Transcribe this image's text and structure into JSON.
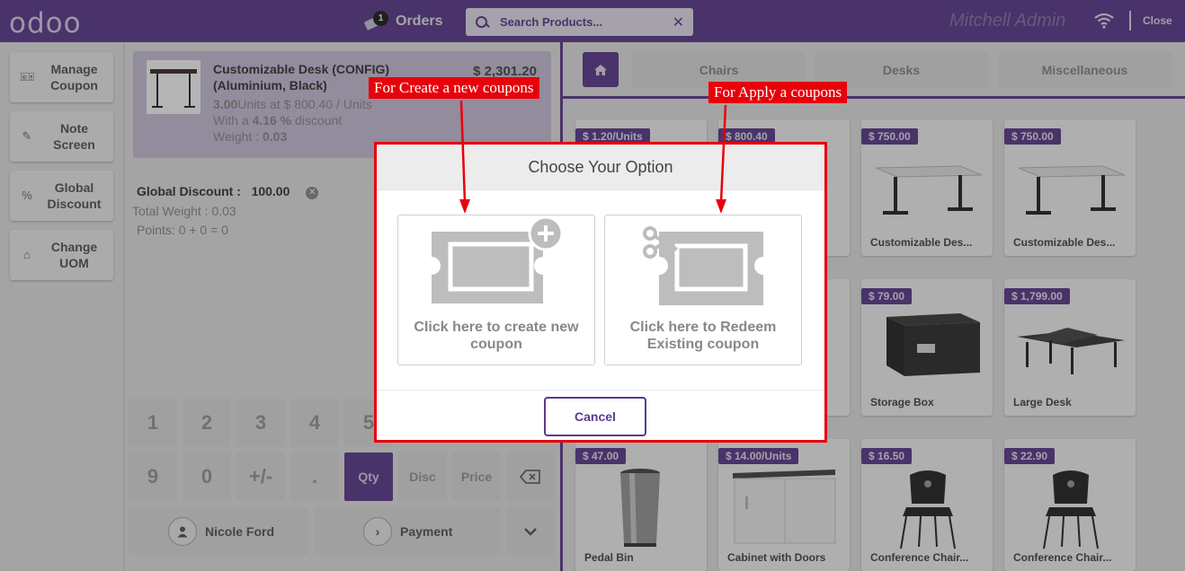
{
  "header": {
    "logo": "odoo",
    "orders_label": "Orders",
    "orders_count": "1",
    "search_placeholder": "Search Products...",
    "user": "Mitchell Admin",
    "close_label": "Close"
  },
  "controls": [
    {
      "label": "Manage Coupon",
      "icon": "ticket-icon"
    },
    {
      "label": "Note Screen",
      "icon": "note-icon"
    },
    {
      "label": "Global Discount",
      "icon": "percent-icon"
    },
    {
      "label": "Change UOM",
      "icon": "tag-icon"
    }
  ],
  "order": {
    "line": {
      "name": "Customizable Desk (CONFIG) (Aluminium, Black)",
      "price": "$ 2,301.20",
      "qty": "3.00",
      "unit_text": "Units at $ 800.40 / Units",
      "discount_prefix": "With a ",
      "discount": "4.16 %",
      "discount_suffix": " discount",
      "weight_label": "Weight : ",
      "weight": "0.03"
    },
    "global_discount_label": "Global Discount :",
    "global_discount_value": "100.00",
    "total_weight": "Total Weight : 0.03",
    "points": "Points: 0 + 0 = 0"
  },
  "numpad": {
    "row1": [
      "1",
      "2",
      "3",
      "4",
      "5"
    ],
    "row2": [
      "9",
      "0",
      "+/-",
      ".",
      "Qty",
      "Disc",
      "Price"
    ],
    "customer": "Nicole Ford",
    "payment": "Payment"
  },
  "categories": {
    "home_icon": "home-icon",
    "items": [
      "Chairs",
      "Desks",
      "Miscellaneous"
    ]
  },
  "products": [
    {
      "price": "$ 1.20/Units",
      "name": ""
    },
    {
      "price": "$ 800.40",
      "name": ""
    },
    {
      "price": "$ 750.00",
      "name": "Customizable Des..."
    },
    {
      "price": "$ 750.00",
      "name": "Customizable Des..."
    },
    {
      "price": "$ 79.00",
      "name": "Storage Box"
    },
    {
      "price": "$ 1,799.00",
      "name": "Large Desk"
    },
    {
      "price": "$ 47.00",
      "name": "Pedal Bin"
    },
    {
      "price": "$ 14.00/Units",
      "name": "Cabinet with Doors"
    },
    {
      "price": "$ 16.50",
      "name": "Conference Chair..."
    },
    {
      "price": "$ 22.90",
      "name": "Conference Chair..."
    }
  ],
  "modal": {
    "title": "Choose Your Option",
    "option_create": "Click here to create new coupon",
    "option_redeem": "Click here to Redeem Existing coupon",
    "cancel": "Cancel"
  },
  "annotations": {
    "create": "For Create a new  coupons",
    "apply": "For Apply a coupons"
  },
  "colors": {
    "brand": "#5b3a8e",
    "annotation": "#e8000b"
  }
}
